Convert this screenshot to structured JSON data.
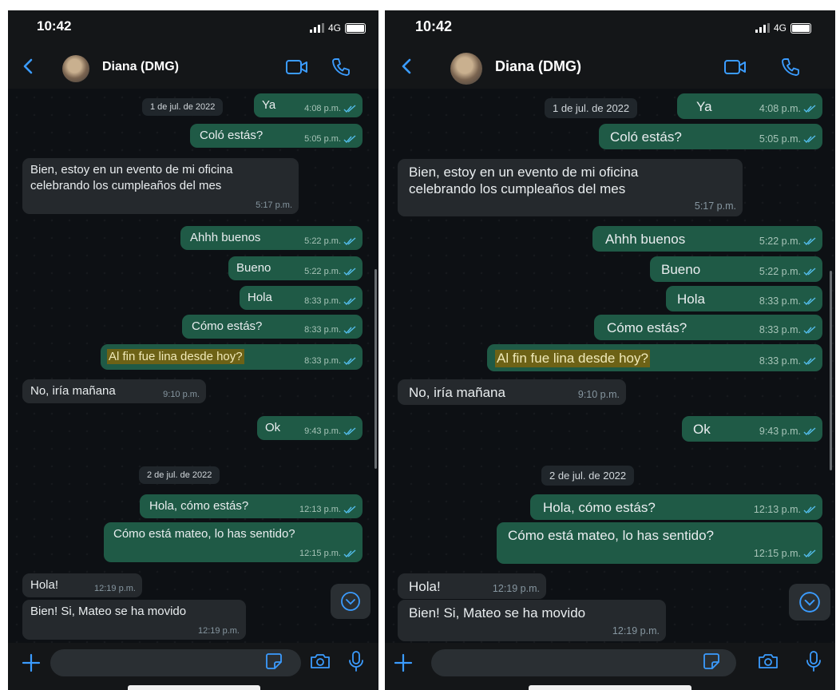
{
  "status": {
    "time": "10:42",
    "network": "4G"
  },
  "contact": {
    "name": "Diana (DMG)"
  },
  "dates": {
    "d1": "1 de jul. de 2022",
    "d2": "2 de jul. de 2022"
  },
  "messages": [
    {
      "text": "Ya",
      "time": "4:08 p.m."
    },
    {
      "text": "Coló estás?",
      "time": "5:05 p.m."
    },
    {
      "line1": "Bien, estoy en un evento de mi oficina",
      "line2": "celebrando los cumpleaños del mes",
      "time": "5:17 p.m."
    },
    {
      "text": "Ahhh buenos",
      "time": "5:22 p.m."
    },
    {
      "text": "Bueno",
      "time": "5:22 p.m."
    },
    {
      "text": "Hola",
      "time": "8:33 p.m."
    },
    {
      "text": "Cómo estás?",
      "time": "8:33 p.m."
    },
    {
      "text": "Al fin fue lina desde hoy?",
      "time": "8:33 p.m."
    },
    {
      "text": "No, iría mañana",
      "time": "9:10 p.m."
    },
    {
      "text": "Ok",
      "time": "9:43 p.m."
    },
    {
      "text": "Hola, cómo estás?",
      "time": "12:13 p.m."
    },
    {
      "text": "Cómo está mateo, lo has sentido?",
      "time": "12:15 p.m."
    },
    {
      "text": "Hola!",
      "time": "12:19 p.m."
    },
    {
      "text": "Bien! Si, Mateo se ha movido",
      "time": "12:19 p.m."
    }
  ],
  "colors": {
    "outgoing": "#1f5a46",
    "incoming": "#25292d",
    "accent": "#3b9cff",
    "highlight": "#6d6216"
  },
  "icons": [
    "back-chevron-icon",
    "video-call-icon",
    "phone-call-icon",
    "plus-icon",
    "sticker-icon",
    "camera-icon",
    "microphone-icon",
    "scroll-down-icon",
    "double-check-icon"
  ]
}
